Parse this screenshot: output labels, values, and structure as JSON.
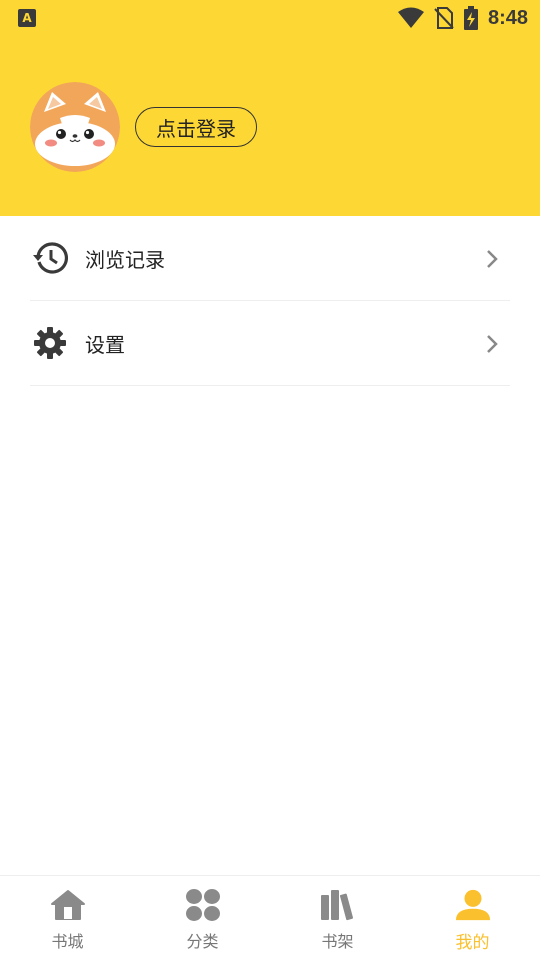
{
  "status_bar": {
    "app_icon": "A",
    "time": "8:48",
    "icons": [
      "wifi-icon",
      "no-sim-icon",
      "battery-charging-icon"
    ]
  },
  "profile": {
    "avatar": "shiba-dog-avatar",
    "login_label": "点击登录"
  },
  "menu": {
    "items": [
      {
        "label": "浏览记录",
        "icon": "history-icon"
      },
      {
        "label": "设置",
        "icon": "gear-icon"
      }
    ]
  },
  "tab_bar": {
    "tabs": [
      {
        "label": "书城",
        "icon": "home-icon"
      },
      {
        "label": "分类",
        "icon": "category-icon"
      },
      {
        "label": "书架",
        "icon": "bookshelf-icon"
      },
      {
        "label": "我的",
        "icon": "person-icon",
        "active": true
      }
    ]
  },
  "colors": {
    "header_bg": "#FDD835",
    "active_tab": "#FBC02D",
    "inactive_tab": "#777777"
  }
}
